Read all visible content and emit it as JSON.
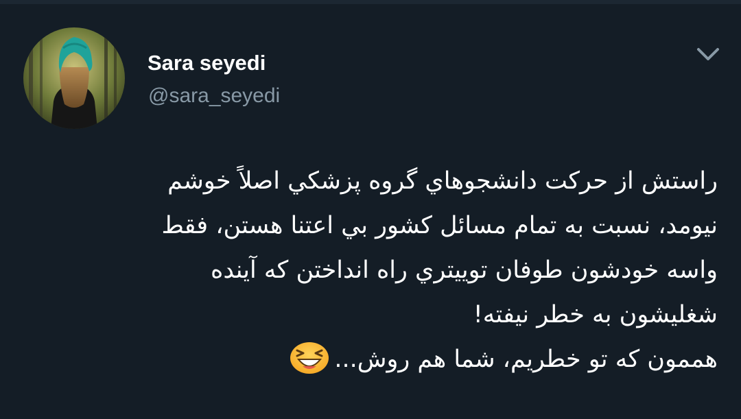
{
  "author": {
    "display_name": "Sara seyedi",
    "handle": "@sara_seyedi",
    "avatar_icon": "profile-photo"
  },
  "tweet": {
    "lines": [
      "راستش از حرکت دانشجوهاي گروه پزشکي اصلاً خوشم",
      "نيومد، نسبت به تمام مسائل کشور بي اعتنا هستن، فقط",
      "واسه خودشون طوفان توييتري راه انداختن که آينده",
      "شغليشون به خطر نيفته!",
      "هممون که تو خطريم، شما هم روش..."
    ],
    "emoji": "laughing-face-emoji"
  },
  "controls": {
    "caret_icon": "chevron-down-icon"
  },
  "colors": {
    "background": "#141d26",
    "text": "#ffffff",
    "secondary_text": "#8899a6",
    "caret": "#8899a6"
  }
}
